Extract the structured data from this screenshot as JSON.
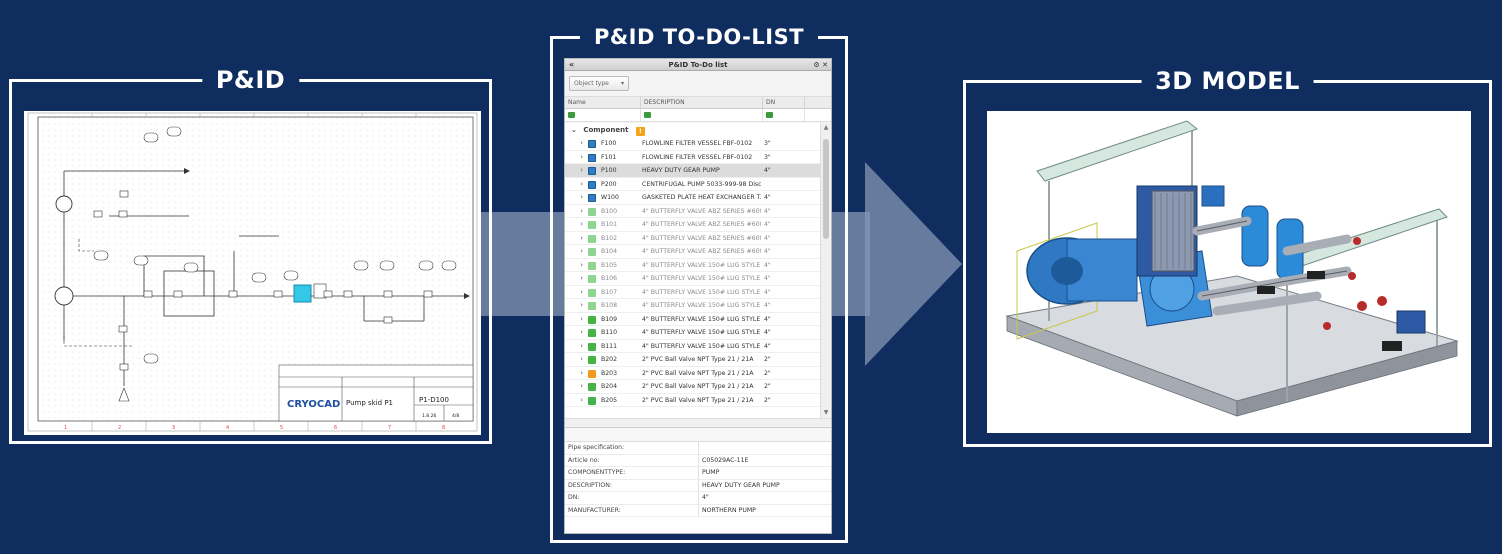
{
  "sections": {
    "pid_title": "P&ID",
    "todo_title": "P&ID TO-DO-LIST",
    "model_title": "3D MODEL"
  },
  "pid_drawing": {
    "company_logo_text": "CRYOCAD",
    "drawing_title": "Pump skid P1",
    "drawing_number": "P1-D100",
    "revision": "1.8.26",
    "sheet": "4/8",
    "column_markers": [
      "1",
      "2",
      "3",
      "4",
      "5",
      "6",
      "7",
      "8"
    ]
  },
  "todo_window": {
    "title": "P&ID To-Do list",
    "collapse_glyph": "«",
    "object_type_placeholder": "Object type",
    "columns": [
      "Name",
      "DESCRIPTION",
      "DN"
    ],
    "group_label": "Component",
    "group_badge": "!",
    "rows": [
      {
        "name": "F100",
        "desc": "FLOWLINE FILTER VESSEL FBF-0102",
        "dn": "3\"",
        "status": "blue",
        "dim": false
      },
      {
        "name": "F101",
        "desc": "FLOWLINE FILTER VESSEL FBF-0102",
        "dn": "3\"",
        "status": "blue",
        "dim": false
      },
      {
        "name": "P100",
        "desc": "HEAVY DUTY GEAR PUMP",
        "dn": "4\"",
        "status": "blue",
        "dim": false,
        "selected": true
      },
      {
        "name": "P200",
        "desc": "CENTRIFUGAL PUMP 5033-999-98 Disc...",
        "dn": "",
        "status": "blue",
        "dim": false
      },
      {
        "name": "W100",
        "desc": "GASKETED PLATE HEAT EXCHANGER T...",
        "dn": "4\"",
        "status": "blue",
        "dim": false
      },
      {
        "name": "B100",
        "desc": "4\" BUTTERFLY VALVE ABZ SERIES #600",
        "dn": "4\"",
        "status": "lgreen",
        "dim": true
      },
      {
        "name": "B101",
        "desc": "4\" BUTTERFLY VALVE ABZ SERIES #600",
        "dn": "4\"",
        "status": "lgreen",
        "dim": true
      },
      {
        "name": "B102",
        "desc": "4\" BUTTERFLY VALVE ABZ SERIES #600",
        "dn": "4\"",
        "status": "lgreen",
        "dim": true
      },
      {
        "name": "B104",
        "desc": "4\" BUTTERFLY VALVE ABZ SERIES #600",
        "dn": "4\"",
        "status": "lgreen",
        "dim": true
      },
      {
        "name": "B105",
        "desc": "4\" BUTTERFLY VALVE 150# LUG STYLE",
        "dn": "4\"",
        "status": "lgreen",
        "dim": true
      },
      {
        "name": "B106",
        "desc": "4\" BUTTERFLY VALVE 150# LUG STYLE",
        "dn": "4\"",
        "status": "lgreen",
        "dim": true
      },
      {
        "name": "B107",
        "desc": "4\" BUTTERFLY VALVE 150# LUG STYLE",
        "dn": "4\"",
        "status": "lgreen",
        "dim": true
      },
      {
        "name": "B108",
        "desc": "4\" BUTTERFLY VALVE 150# LUG STYLE",
        "dn": "4\"",
        "status": "lgreen",
        "dim": true
      },
      {
        "name": "B109",
        "desc": "4\" BUTTERFLY VALVE 150# LUG STYLE",
        "dn": "4\"",
        "status": "green",
        "dim": false
      },
      {
        "name": "B110",
        "desc": "4\" BUTTERFLY VALVE 150# LUG STYLE",
        "dn": "4\"",
        "status": "green",
        "dim": false
      },
      {
        "name": "B111",
        "desc": "4\" BUTTERFLY VALVE 150# LUG STYLE",
        "dn": "4\"",
        "status": "green",
        "dim": false
      },
      {
        "name": "B202",
        "desc": "2\" PVC Ball Valve NPT Type 21 / 21A",
        "dn": "2\"",
        "status": "green",
        "dim": false
      },
      {
        "name": "B203",
        "desc": "2\" PVC Ball Valve NPT Type 21 / 21A",
        "dn": "2\"",
        "status": "orange",
        "dim": false
      },
      {
        "name": "B204",
        "desc": "2\" PVC Ball Valve NPT Type 21 / 21A",
        "dn": "2\"",
        "status": "green",
        "dim": false
      },
      {
        "name": "B205",
        "desc": "2\" PVC Ball Valve NPT Type 21 / 21A",
        "dn": "2\"",
        "status": "green",
        "dim": false
      }
    ],
    "properties": [
      {
        "key": "Pipe specification:",
        "value": ""
      },
      {
        "key": "Article no:",
        "value": "C05029AC-11E"
      },
      {
        "key": "COMPONENTTYPE:",
        "value": "PUMP"
      },
      {
        "key": "DESCRIPTION:",
        "value": "HEAVY DUTY GEAR PUMP"
      },
      {
        "key": "DN:",
        "value": "4\""
      },
      {
        "key": "MANUFACTURER:",
        "value": "NORTHERN PUMP"
      }
    ]
  },
  "colors": {
    "background": "#0f2d5e",
    "frame": "#ffffff",
    "arrow": "#8a9cbb",
    "status_blue": "#2d7ec7",
    "status_green": "#43b547",
    "status_orange": "#f39a1e"
  }
}
